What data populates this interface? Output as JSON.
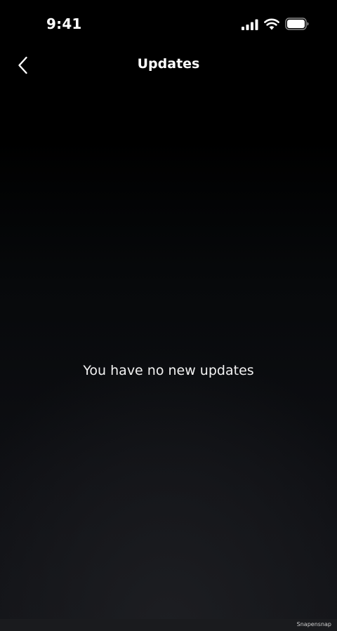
{
  "status_bar": {
    "time": "9:41",
    "icons": [
      "signal-icon",
      "wifi-icon",
      "battery-icon"
    ]
  },
  "nav": {
    "title": "Updates",
    "back_icon": "chevron-left-icon"
  },
  "main": {
    "empty_message": "You have no new updates"
  },
  "watermark": "Snapensnap",
  "colors": {
    "background_top": "#000000",
    "background_bottom": "#121317",
    "text": "#ffffff"
  }
}
